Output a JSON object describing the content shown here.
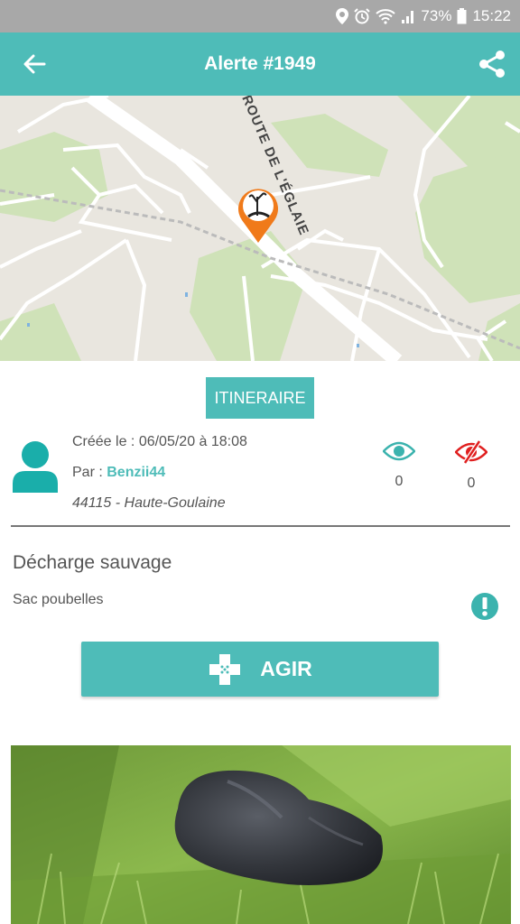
{
  "status_bar": {
    "battery": "73%",
    "time": "15:22",
    "icons": [
      "location-icon",
      "alarm-icon",
      "wifi-icon",
      "signal-icon",
      "battery-icon"
    ]
  },
  "app_bar": {
    "title": "Alerte #1949",
    "icons": [
      "back-arrow-icon",
      "share-icon"
    ]
  },
  "map": {
    "road_label": "ROUTE DE L'ÉGLAIE",
    "marker_icon": "dead-tree-pollution-icon"
  },
  "actions": {
    "itinerary_label": "ITINERAIRE",
    "act_label": "AGIR",
    "act_icon": "bandage-cross-icon"
  },
  "alert": {
    "created": "Créée le : 06/05/20 à 18:08",
    "by_prefix": "Par : ",
    "author": "Benzii44",
    "location": "44115 - Haute-Goulaine",
    "views_count": "0",
    "hidden_count": "0",
    "category": "Décharge sauvage",
    "description": "Sac poubelles"
  },
  "colors": {
    "accent": "#4ebcb8",
    "status_bar": "#a8a8a8",
    "hidden_icon": "#e02020",
    "marker": "#f07a1a"
  }
}
